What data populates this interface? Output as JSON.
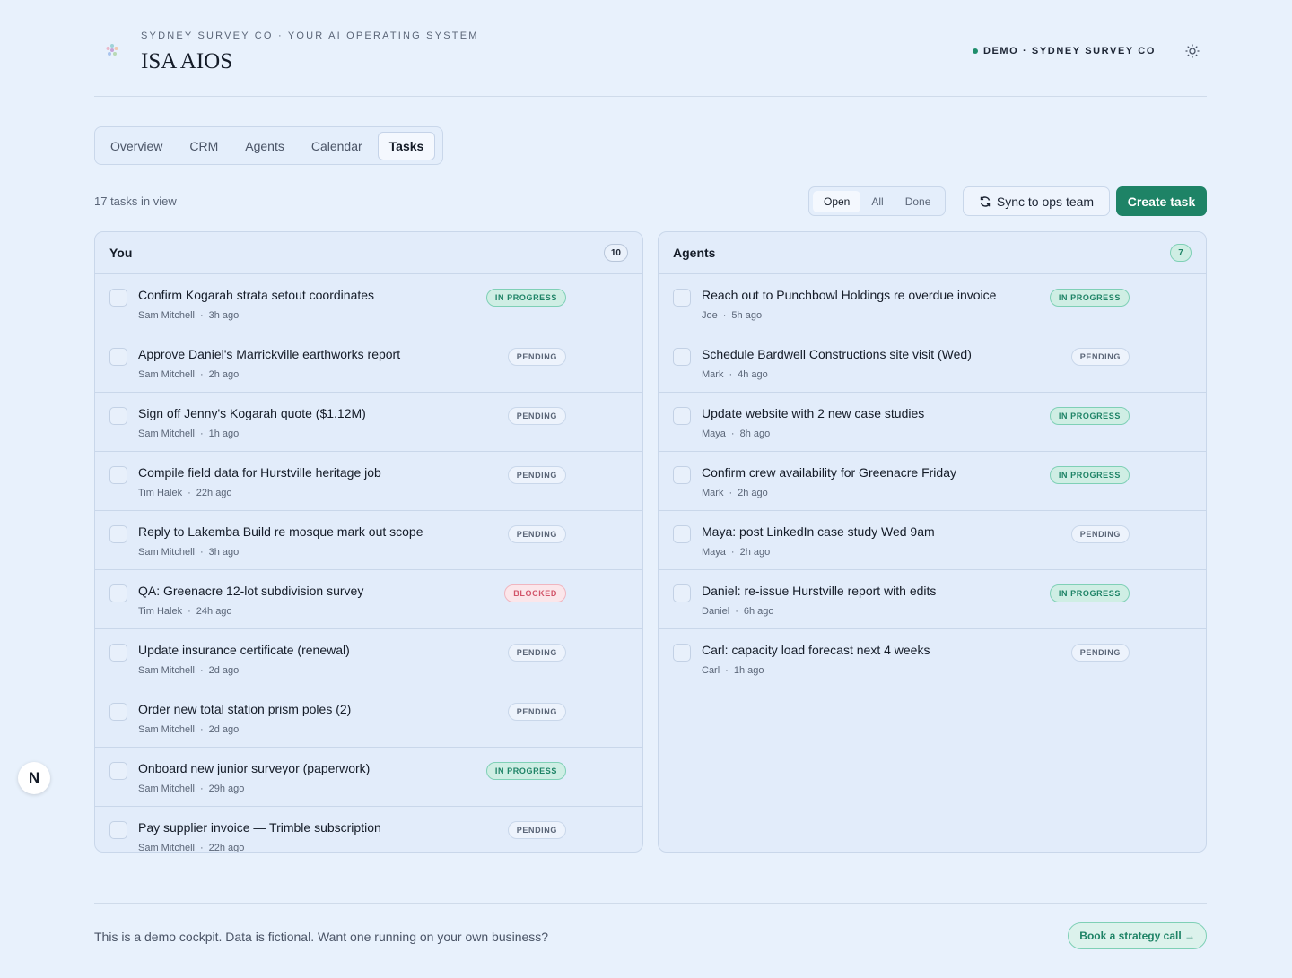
{
  "header": {
    "eyebrow": "SYDNEY SURVEY CO · YOUR AI OPERATING SYSTEM",
    "brand": "ISA AIOS",
    "demo_label": "DEMO · SYDNEY SURVEY CO",
    "status_color": "#1f8e6c",
    "theme_icon": "sun-icon"
  },
  "tabs": [
    {
      "label": "Overview",
      "active": false
    },
    {
      "label": "CRM",
      "active": false
    },
    {
      "label": "Agents",
      "active": false
    },
    {
      "label": "Calendar",
      "active": false
    },
    {
      "label": "Tasks",
      "active": true
    }
  ],
  "toolbar": {
    "count_text": "17 tasks in view",
    "filters": [
      {
        "label": "Open",
        "active": true
      },
      {
        "label": "All",
        "active": false
      },
      {
        "label": "Done",
        "active": false
      }
    ],
    "sync_label": "Sync to ops team",
    "create_label": "Create task",
    "accent": "#1e8366"
  },
  "you": {
    "title": "You",
    "count": "10",
    "tasks": [
      {
        "title": "Confirm Kogarah strata setout coordinates",
        "owner": "Sam Mitchell",
        "time": "3h ago",
        "status": "IN PROGRESS",
        "kind": "inprog"
      },
      {
        "title": "Approve Daniel's Marrickville earthworks report",
        "owner": "Sam Mitchell",
        "time": "2h ago",
        "status": "PENDING",
        "kind": "pending"
      },
      {
        "title": "Sign off Jenny's Kogarah quote ($1.12M)",
        "owner": "Sam Mitchell",
        "time": "1h ago",
        "status": "PENDING",
        "kind": "pending"
      },
      {
        "title": "Compile field data for Hurstville heritage job",
        "owner": "Tim Halek",
        "time": "22h ago",
        "status": "PENDING",
        "kind": "pending"
      },
      {
        "title": "Reply to Lakemba Build re mosque mark out scope",
        "owner": "Sam Mitchell",
        "time": "3h ago",
        "status": "PENDING",
        "kind": "pending"
      },
      {
        "title": "QA: Greenacre 12-lot subdivision survey",
        "owner": "Tim Halek",
        "time": "24h ago",
        "status": "BLOCKED",
        "kind": "blocked"
      },
      {
        "title": "Update insurance certificate (renewal)",
        "owner": "Sam Mitchell",
        "time": "2d ago",
        "status": "PENDING",
        "kind": "pending"
      },
      {
        "title": "Order new total station prism poles (2)",
        "owner": "Sam Mitchell",
        "time": "2d ago",
        "status": "PENDING",
        "kind": "pending"
      },
      {
        "title": "Onboard new junior surveyor (paperwork)",
        "owner": "Sam Mitchell",
        "time": "29h ago",
        "status": "IN PROGRESS",
        "kind": "inprog"
      },
      {
        "title": "Pay supplier invoice — Trimble subscription",
        "owner": "Sam Mitchell",
        "time": "22h ago",
        "status": "PENDING",
        "kind": "pending"
      }
    ]
  },
  "agents": {
    "title": "Agents",
    "count": "7",
    "tasks": [
      {
        "title": "Reach out to Punchbowl Holdings re overdue invoice",
        "owner": "Joe",
        "time": "5h ago",
        "status": "IN PROGRESS",
        "kind": "inprog"
      },
      {
        "title": "Schedule Bardwell Constructions site visit (Wed)",
        "owner": "Mark",
        "time": "4h ago",
        "status": "PENDING",
        "kind": "pending"
      },
      {
        "title": "Update website with 2 new case studies",
        "owner": "Maya",
        "time": "8h ago",
        "status": "IN PROGRESS",
        "kind": "inprog"
      },
      {
        "title": "Confirm crew availability for Greenacre Friday",
        "owner": "Mark",
        "time": "2h ago",
        "status": "IN PROGRESS",
        "kind": "inprog"
      },
      {
        "title": "Maya: post LinkedIn case study Wed 9am",
        "owner": "Maya",
        "time": "2h ago",
        "status": "PENDING",
        "kind": "pending"
      },
      {
        "title": "Daniel: re-issue Hurstville report with edits",
        "owner": "Daniel",
        "time": "6h ago",
        "status": "IN PROGRESS",
        "kind": "inprog"
      },
      {
        "title": "Carl: capacity load forecast next 4 weeks",
        "owner": "Carl",
        "time": "1h ago",
        "status": "PENDING",
        "kind": "pending"
      }
    ]
  },
  "floating": {
    "label": "N"
  },
  "footer": {
    "text": "This is a demo cockpit. Data is fictional. Want one running on your own business?",
    "cta": "Book a strategy call →"
  }
}
